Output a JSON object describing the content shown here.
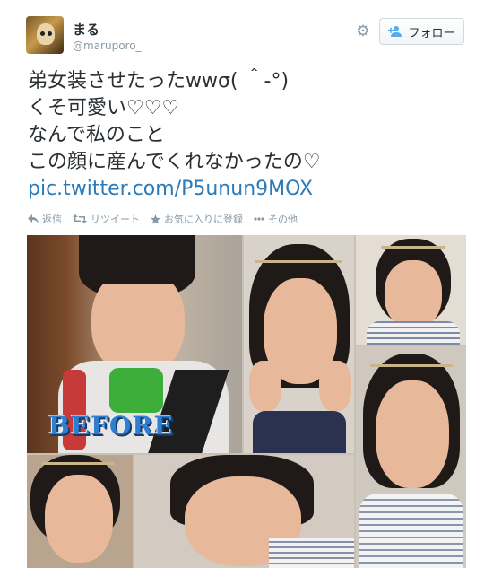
{
  "user": {
    "display_name": "まる",
    "screen_name": "@maruporo_"
  },
  "header": {
    "follow_label": "フォロー",
    "settings_icon": "gear-icon",
    "follow_icon": "add-person-icon"
  },
  "tweet": {
    "lines": [
      "弟女装させたったwwσ( ＾-°)",
      "くそ可愛い♡♡♡",
      "なんで私のこと",
      "この顔に産んでくれなかったの♡"
    ],
    "link": "pic.twitter.com/P5unun9MOX"
  },
  "actions": {
    "reply": "返信",
    "retweet": "リツイート",
    "favorite": "お気に入りに登録",
    "more": "その他"
  },
  "photo": {
    "before_label": "BEFORE"
  },
  "colors": {
    "link": "#2b7bb9",
    "muted": "#8899a6",
    "text": "#292f33"
  }
}
